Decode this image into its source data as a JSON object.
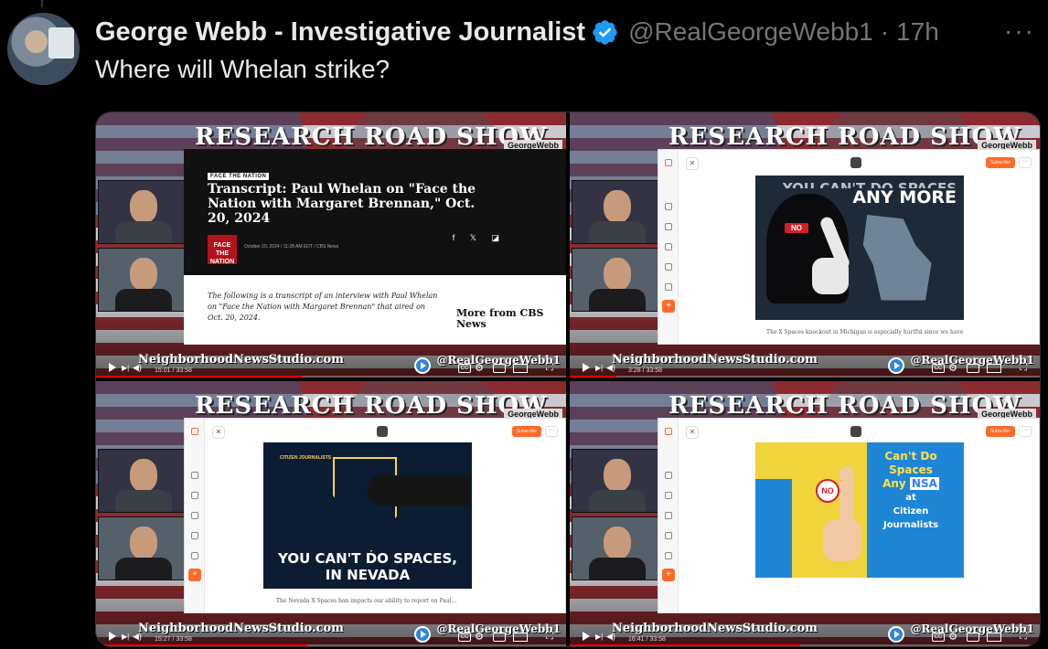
{
  "post": {
    "author_name": "George Webb - Investigative Journalist",
    "handle": "@RealGeorgeWebb1",
    "separator": "·",
    "time_ago": "17h",
    "more_label": "···",
    "text": "Where will Whelan strike?"
  },
  "colors": {
    "background": "#000000",
    "primary_text": "#e7e9ea",
    "secondary_text": "#71767b",
    "verified_blue": "#1d9bf0",
    "accent_orange": "#ff6a2a"
  },
  "media": [
    {
      "show_title": "RESEARCH ROAD SHOW",
      "brand": "GeorgeWebb",
      "site": "NeighborhoodNewsStudio.com",
      "handle_overlay": "@RealGeorgeWebb1",
      "timestamp": "15:01 / 33:58",
      "progress": 0.44,
      "content": {
        "kind": "article",
        "kicker": "FACE THE NATION",
        "headline": "Transcript: Paul Whelan on \"Face the Nation with Margaret Brennan,\" Oct. 20, 2024",
        "logo_text": "FACE THE NATION",
        "dateline": "October 20, 2024 / 11:28 AM EDT / CBS News",
        "body": "The following is a transcript of an interview with Paul Whelan on \"Face the Nation with Margaret Brennan\" that aired on Oct. 20, 2024.",
        "sidebar": "More from CBS News"
      }
    },
    {
      "show_title": "RESEARCH ROAD SHOW",
      "brand": "GeorgeWebb",
      "site": "NeighborhoodNewsStudio.com",
      "handle_overlay": "@RealGeorgeWebb1",
      "timestamp": "3:28 / 33:58",
      "progress": 0.1,
      "content": {
        "kind": "michigan",
        "subscribe_label": "Subscribe",
        "title_partial": "YOU CAN'T DO SPACES",
        "title": "ANY MORE",
        "badge": "NO",
        "caption": "The X Spaces knockout in Michigan is especially hurtful since we have"
      }
    },
    {
      "show_title": "RESEARCH ROAD SHOW",
      "brand": "GeorgeWebb",
      "site": "NeighborhoodNewsStudio.com",
      "handle_overlay": "@RealGeorgeWebb1",
      "timestamp": "15:27 / 33:58",
      "progress": 0.45,
      "content": {
        "kind": "nevada",
        "subscribe_label": "Subscribe",
        "label": "CITIZEN JOURNALISTS",
        "text_line1": "YOU CAN'T DO SPACES,",
        "text_line2": "IN NEVADA",
        "caption": "The Nevada X Spaces ban impacts our ability to report on Paul..."
      }
    },
    {
      "show_title": "RESEARCH ROAD SHOW",
      "brand": "GeorgeWebb",
      "site": "NeighborhoodNewsStudio.com",
      "handle_overlay": "@RealGeorgeWebb1",
      "timestamp": "16:41 / 33:58",
      "progress": 0.49,
      "content": {
        "kind": "florida",
        "subscribe_label": "Subscribe",
        "badge": "NO",
        "line1": "Can't Do",
        "line2": "Spaces",
        "line3a": "Any",
        "line3b": "NSA",
        "line4": "at",
        "line5": "Citizen",
        "line6": "Journalists"
      }
    }
  ]
}
